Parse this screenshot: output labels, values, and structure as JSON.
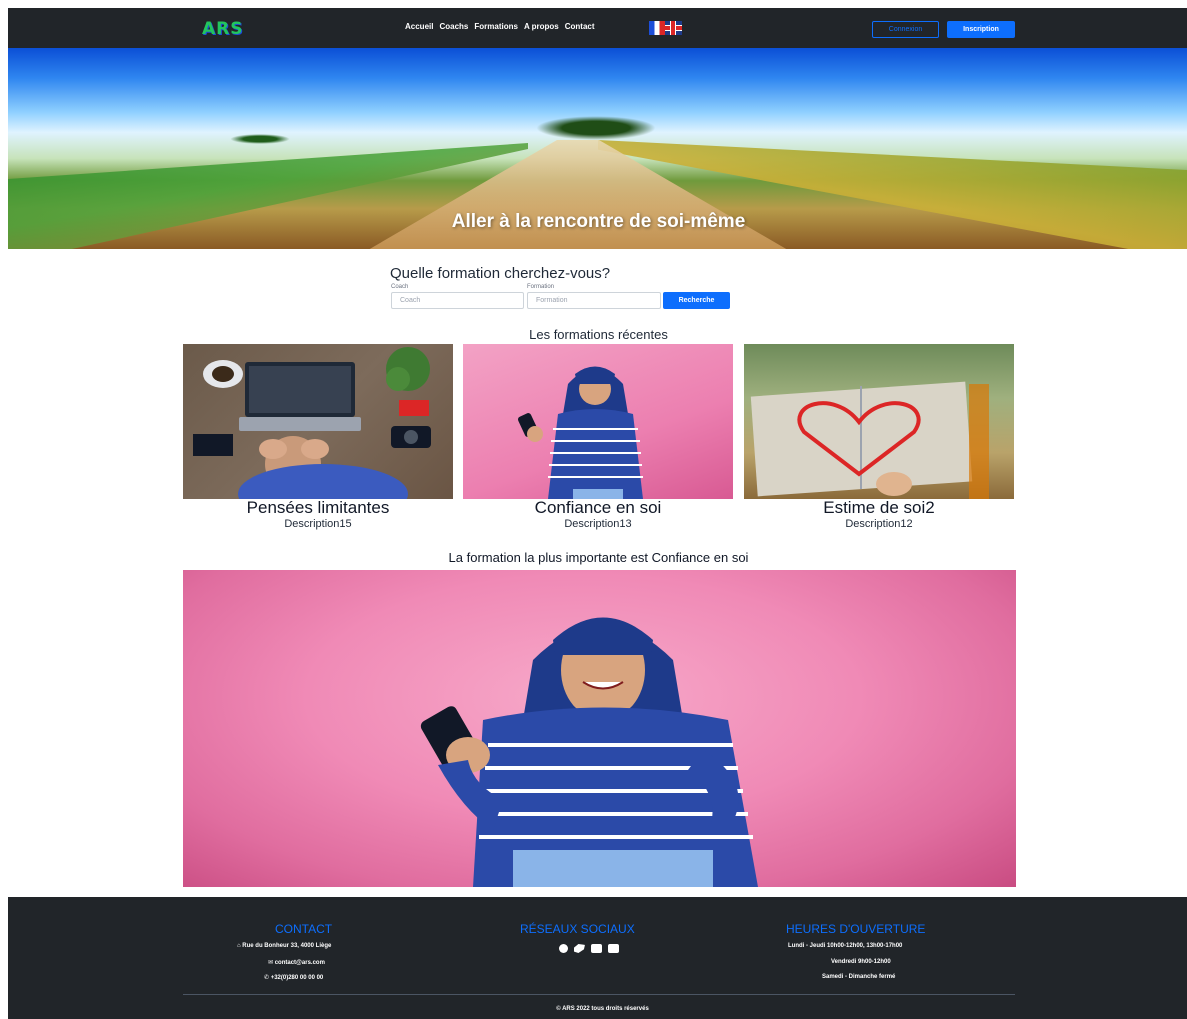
{
  "nav": {
    "logo": "ARS",
    "links": [
      "Accueil",
      "Coachs",
      "Formations",
      "A propos",
      "Contact"
    ],
    "login_label": "Connexion",
    "signup_label": "Inscription"
  },
  "hero": {
    "title": "Aller à la rencontre de soi-même"
  },
  "search": {
    "title": "Quelle formation cherchez-vous?",
    "coach_label": "Coach",
    "coach_placeholder": "Coach",
    "formation_label": "Formation",
    "formation_placeholder": "Formation",
    "button_label": "Recherche"
  },
  "recent": {
    "title": "Les formations récentes",
    "cards": [
      {
        "title": "Pensées limitantes",
        "description": "Description15"
      },
      {
        "title": "Confiance en soi",
        "description": "Description13"
      },
      {
        "title": "Estime de soi2",
        "description": "Description12"
      }
    ]
  },
  "featured": {
    "title": "La formation la plus importante est Confiance en soi"
  },
  "footer": {
    "contact": {
      "heading": "CONTACT",
      "address": "Rue du Bonheur 33, 4000 Liège",
      "email": "contact@ars.com",
      "phone": "+32(0)280 00 00 00"
    },
    "social": {
      "heading": "RÉSEAUX SOCIAUX",
      "icons": [
        "facebook-icon",
        "twitter-icon",
        "linkedin-icon",
        "youtube-icon"
      ]
    },
    "hours": {
      "heading": "HEURES D'OUVERTURE",
      "lines": [
        "Lundi - Jeudi 10h00-12h00, 13h00-17h00",
        "Vendredi 9h00-12h00",
        "Samedi - Dimanche fermé"
      ]
    },
    "copyright": "© ARS 2022 tous droits réservés"
  },
  "colors": {
    "accent": "#0d6efd",
    "dark": "#212529",
    "logo": "#22c55e"
  }
}
